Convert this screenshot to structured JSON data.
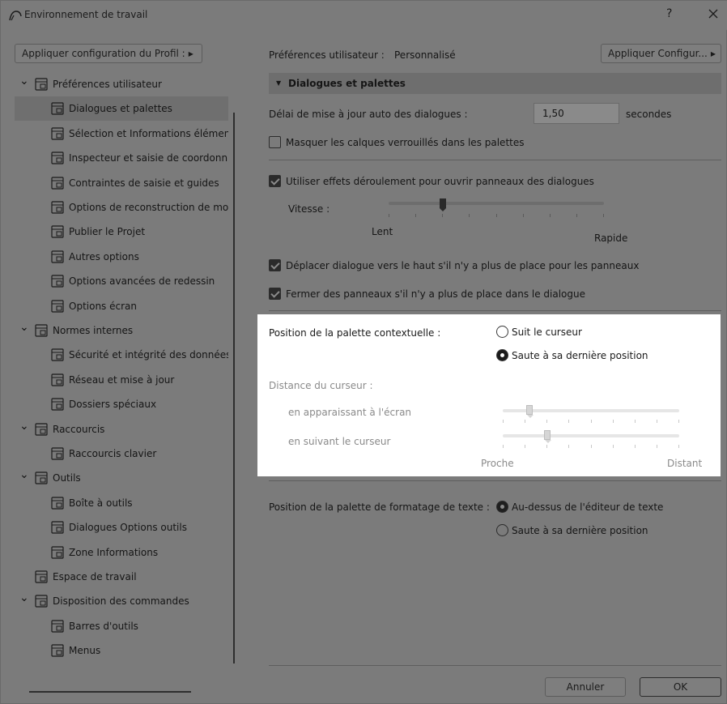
{
  "window": {
    "title": "Environnement de travail",
    "help": "?",
    "close": "✕"
  },
  "left": {
    "apply_profile_label": "Appliquer configuration du Profil :"
  },
  "tree": [
    {
      "label": "Préférences utilisateur",
      "expanded": true,
      "icon": "user-prefs-icon"
    },
    {
      "label": "Dialogues et palettes",
      "selected": true,
      "icon": "dialogs-palettes-icon"
    },
    {
      "label": "Sélection et Informations élémen",
      "icon": "selection-info-icon"
    },
    {
      "label": "Inspecteur et saisie de coordonn",
      "icon": "xyz-inspector-icon"
    },
    {
      "label": "Contraintes de saisie et guides",
      "icon": "cursor-guides-icon"
    },
    {
      "label": "Options de reconstruction de mo",
      "icon": "rebuild-options-icon"
    },
    {
      "label": "Publier le Projet",
      "icon": "publish-icon"
    },
    {
      "label": "Autres options",
      "icon": "other-options-icon"
    },
    {
      "label": "Options avancées de redessin",
      "icon": "redraw-options-icon"
    },
    {
      "label": "Options écran",
      "icon": "screen-options-icon"
    },
    {
      "label": "Normes internes",
      "expanded": true,
      "icon": "company-standards-icon"
    },
    {
      "label": "Sécurité et intégrité des données",
      "icon": "data-safety-icon"
    },
    {
      "label": "Réseau et mise à jour",
      "icon": "network-globe-icon"
    },
    {
      "label": "Dossiers spéciaux",
      "icon": "special-folders-icon"
    },
    {
      "label": "Raccourcis",
      "expanded": true,
      "icon": "shortcuts-icon"
    },
    {
      "label": "Raccourcis clavier",
      "icon": "keyboard-shortcuts-icon"
    },
    {
      "label": "Outils",
      "expanded": true,
      "icon": "tools-icon"
    },
    {
      "label": "Boîte à outils",
      "icon": "toolbox-icon"
    },
    {
      "label": "Dialogues Options outils",
      "icon": "tool-settings-icon"
    },
    {
      "label": "Zone Informations",
      "icon": "info-box-icon"
    },
    {
      "label": "Espace de travail",
      "icon": "work-environment-icon"
    },
    {
      "label": "Disposition des commandes",
      "expanded": true,
      "icon": "command-layout-icon"
    },
    {
      "label": "Barres d'outils",
      "icon": "toolbars-icon"
    },
    {
      "label": "Menus",
      "icon": "menus-icon"
    }
  ],
  "right": {
    "prefs_label": "Préférences utilisateur :",
    "prefs_value": "Personnalisé",
    "apply_config_label": "Appliquer Configur...",
    "section_title": "Dialogues et palettes",
    "update_delay_label": "Délai de mise à jour auto des dialogues :",
    "update_delay_value": "1,50",
    "update_delay_unit": "secondes",
    "hide_locked_layers": {
      "label": "Masquer les calques verrouillés dans les palettes",
      "checked": false
    },
    "use_scroll_effects": {
      "label": "Utiliser effets déroulement pour ouvrir panneaux des dialogues",
      "checked": true
    },
    "speed_label": "Vitesse :",
    "speed_value": 0.25,
    "speed_min": "Lent",
    "speed_max": "Rapide",
    "move_dialog_up": {
      "label": "Déplacer dialogue vers le haut s'il n'y a plus de place pour les panneaux",
      "checked": true
    },
    "close_panels": {
      "label": "Fermer des panneaux s'il n'y a plus de place dans le dialogue",
      "checked": true
    },
    "context_palette_label": "Position de la palette contextuelle :",
    "context_palette_options": [
      {
        "label": "Suit le curseur",
        "selected": false
      },
      {
        "label": "Saute à sa dernière position",
        "selected": true
      }
    ],
    "cursor_distance_label": "Distance du curseur :",
    "on_appear_label": "en apparaissant à l'écran",
    "on_appear_value": 0.15,
    "on_follow_label": "en suivant le curseur",
    "on_follow_value": 0.25,
    "distance_min": "Proche",
    "distance_max": "Distant",
    "text_palette_label": "Position de la palette de formatage de texte :",
    "text_palette_options": [
      {
        "label": "Au-dessus de l'éditeur de texte",
        "selected": true
      },
      {
        "label": "Saute à sa dernière position",
        "selected": false
      }
    ]
  },
  "footer": {
    "cancel": "Annuler",
    "ok": "OK"
  }
}
